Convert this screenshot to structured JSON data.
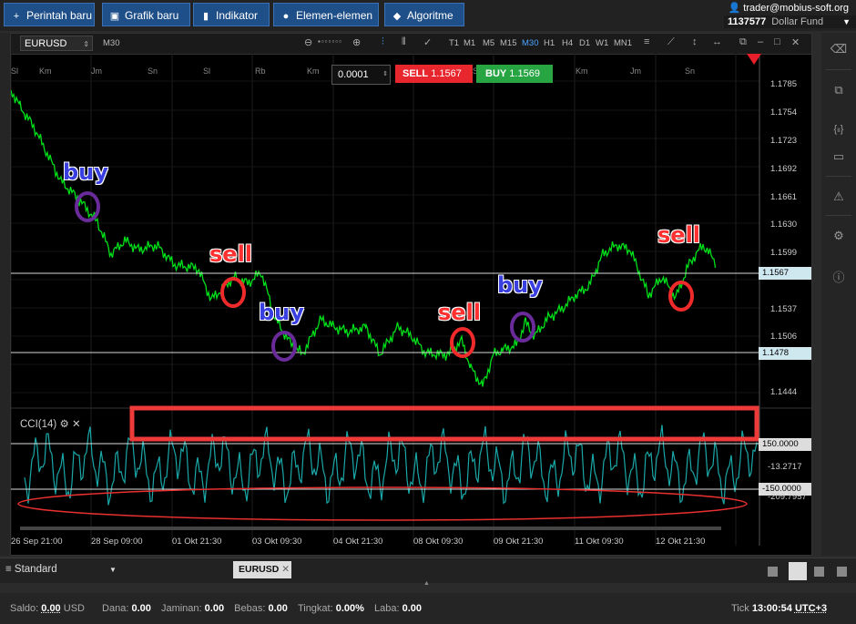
{
  "toolbar": {
    "new_order": "Perintah baru",
    "new_chart": "Grafik baru",
    "indicator": "Indikator",
    "elements": "Elemen-elemen",
    "algorithm": "Algoritme"
  },
  "account": {
    "user_email": "trader@mobius-soft.org",
    "account_id": "1137577",
    "fund_name": "Dollar Fund"
  },
  "chart": {
    "symbol": "EURUSD",
    "timeframe_label": "M30",
    "timeframes": [
      "T1",
      "M1",
      "M5",
      "M15",
      "M30",
      "H1",
      "H4",
      "D1",
      "W1",
      "MN1"
    ],
    "active_timeframe": "M30",
    "day_labels": [
      "Sl",
      "Km",
      "Jm",
      "Sn",
      "Sl",
      "Rb",
      "Km",
      "Jm",
      "Sn",
      "Sl",
      "Rb",
      "Km",
      "Jm",
      "Sn"
    ],
    "trade": {
      "lot": "0.0001",
      "sell_label": "SELL",
      "sell_price": "1.1567",
      "buy_label": "BUY",
      "buy_price": "1.1569"
    },
    "price_ticks": [
      "1.1785",
      "1.1754",
      "1.1723",
      "1.1692",
      "1.1661",
      "1.1630",
      "1.1599",
      "1.1537",
      "1.1506",
      "1.1444"
    ],
    "price_tags": {
      "current": "1.1567",
      "level": "1.1478"
    },
    "cci": {
      "label": "CCI(14)",
      "upper": "150.0000",
      "current": "-13.2717",
      "lower": "-150.0000",
      "min": "-209.7957"
    },
    "time_labels": [
      "26 Sep 21:00",
      "28 Sep 09:00",
      "01 Okt 21:30",
      "03 Okt 09:30",
      "04 Okt 21:30",
      "08 Okt 09:30",
      "09 Okt 21:30",
      "11 Okt 09:30",
      "12 Okt 21:30"
    ],
    "annotations": [
      "buy",
      "sell",
      "buy",
      "sell",
      "buy",
      "sell"
    ]
  },
  "tabs": {
    "layout_name": "Standard",
    "chart_tab": "EURUSD"
  },
  "status": {
    "saldo_label": "Saldo:",
    "saldo_value": "0.00",
    "saldo_currency": "USD",
    "dana_label": "Dana:",
    "dana_value": "0.00",
    "jaminan_label": "Jaminan:",
    "jaminan_value": "0.00",
    "bebas_label": "Bebas:",
    "bebas_value": "0.00",
    "tingkat_label": "Tingkat:",
    "tingkat_value": "0.00%",
    "laba_label": "Laba:",
    "laba_value": "0.00",
    "tick_label": "Tick",
    "tick_time": "13:00:54",
    "tick_tz": "UTC+3"
  },
  "colors": {
    "price_line": "#00e01a",
    "cci_line": "#1aa8a8",
    "sell": "#e8262e",
    "buy": "#27a543",
    "accent": "#1f4f88"
  }
}
